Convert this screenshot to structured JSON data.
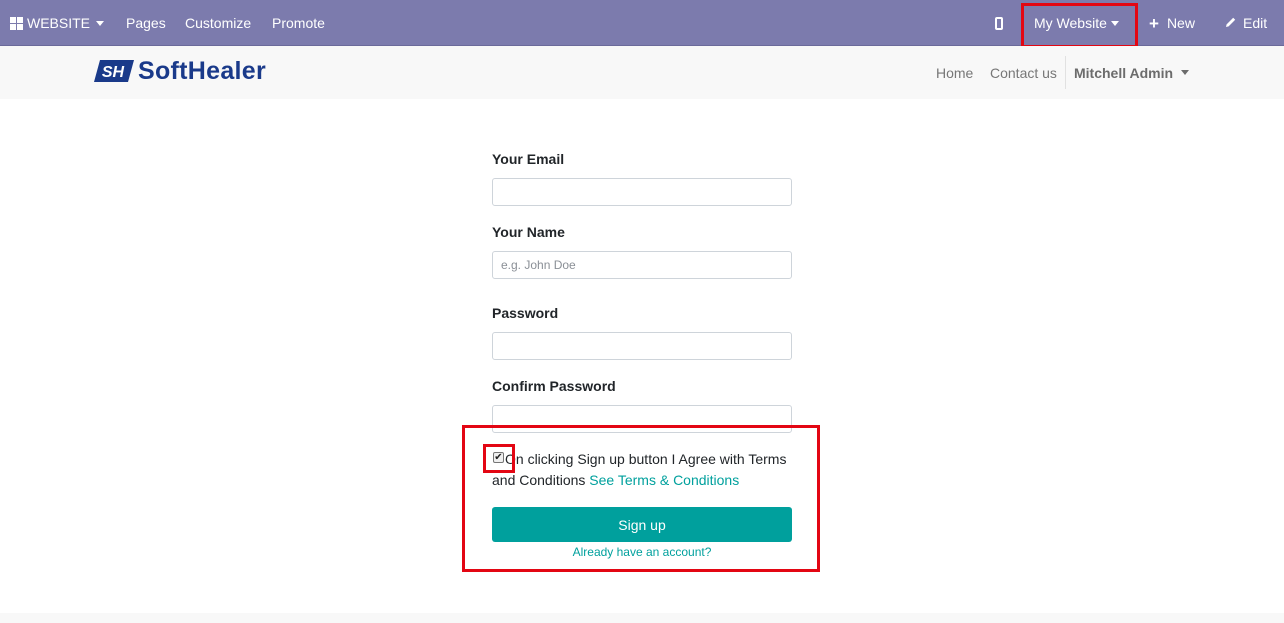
{
  "admin_bar": {
    "app_label": "WEBSITE",
    "menu": [
      "Pages",
      "Customize",
      "Promote"
    ],
    "website_switcher": "My Website",
    "new_label": "New",
    "edit_label": "Edit",
    "icons": {
      "apps": "apps-grid-icon",
      "mobile": "mobile-preview-icon",
      "new": "plus-icon",
      "edit": "pencil-icon"
    }
  },
  "header": {
    "logo_text": "SoftHealer",
    "logo_mark": "SH",
    "nav": [
      "Home",
      "Contact us"
    ],
    "user": "Mitchell Admin"
  },
  "form": {
    "email_label": "Your Email",
    "email_value": "",
    "name_label": "Your Name",
    "name_placeholder": "e.g. John Doe",
    "password_label": "Password",
    "confirm_label": "Confirm Password",
    "terms_checked": true,
    "terms_text": "On clicking Sign up button I Agree with Terms and Conditions",
    "terms_link": "See Terms & Conditions",
    "submit_label": "Sign up",
    "login_link": "Already have an account?"
  },
  "colors": {
    "admin_bar": "#7c7bad",
    "accent": "#00a09d",
    "highlight": "#e30613",
    "logo": "#1a3a8a"
  }
}
